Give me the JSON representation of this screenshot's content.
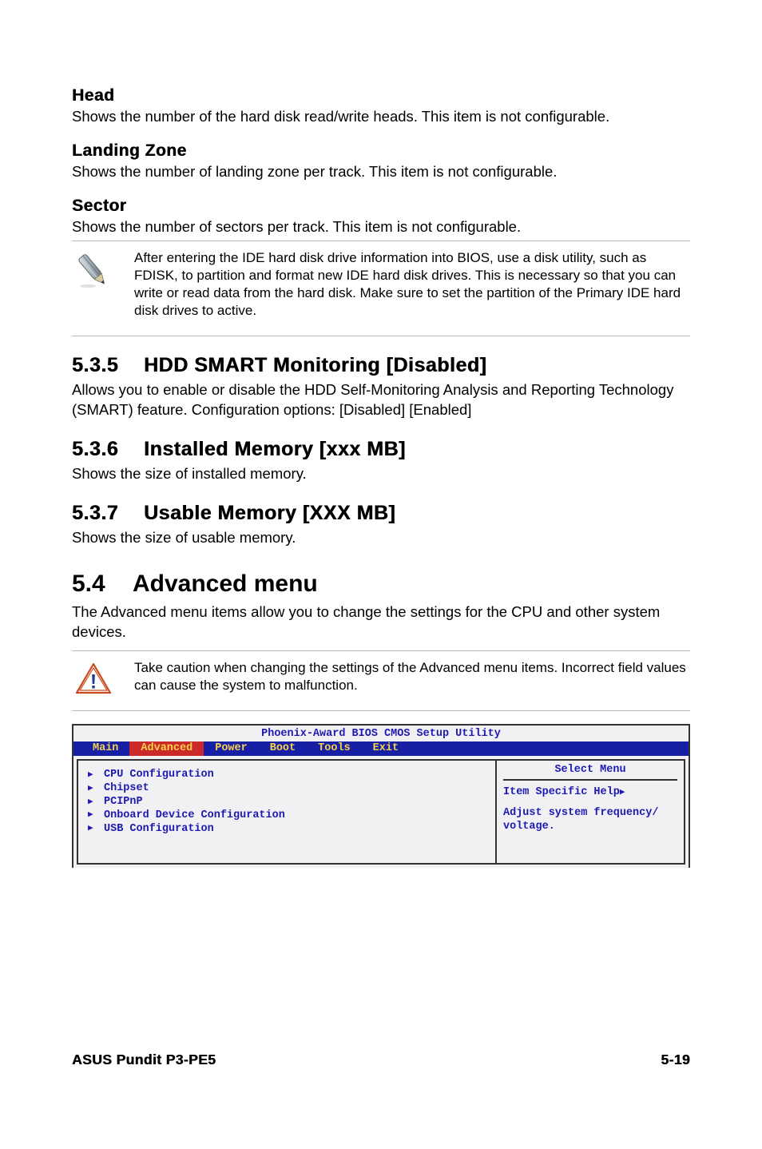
{
  "sections": {
    "head": {
      "title": "Head",
      "body": "Shows the number of the hard disk read/write heads. This item is not configurable."
    },
    "landing_zone": {
      "title": "Landing Zone",
      "body": "Shows the number of landing zone per track. This item is not configurable."
    },
    "sector": {
      "title": "Sector",
      "body": "Shows the number of sectors per track. This item is not configurable."
    },
    "note1": "After entering the IDE hard disk drive information into BIOS, use a disk utility, such as FDISK, to partition and format new IDE hard disk drives. This is necessary so that you can write or read data from the hard disk. Make sure to set the partition of the Primary IDE hard disk drives to active.",
    "s535": {
      "num": "5.3.5",
      "title": "HDD SMART Monitoring [Disabled]",
      "body": "Allows you to enable or disable the HDD Self-Monitoring Analysis and Reporting Technology (SMART) feature. Configuration options: [Disabled] [Enabled]"
    },
    "s536": {
      "num": "5.3.6",
      "title": "Installed Memory [xxx MB]",
      "body": "Shows the size of installed memory."
    },
    "s537": {
      "num": "5.3.7",
      "title": "Usable Memory [XXX MB]",
      "body": "Shows the size of usable memory."
    },
    "s54": {
      "num": "5.4",
      "title": "Advanced menu",
      "body": "The Advanced menu items allow you to change the settings for the CPU and other system devices."
    },
    "note2": "Take caution when changing the settings of the Advanced menu items. Incorrect field values can cause the system to malfunction."
  },
  "bios": {
    "title": "Phoenix-Award BIOS CMOS Setup Utility",
    "tabs": [
      "Main",
      "Advanced",
      "Power",
      "Boot",
      "Tools",
      "Exit"
    ],
    "selected_tab_index": 1,
    "items": [
      "CPU Configuration",
      "Chipset",
      "PCIPnP",
      "Onboard Device Configuration",
      "USB Configuration"
    ],
    "help_title": "Select Menu",
    "help_line1": "Item Specific Help",
    "help_line2": "Adjust system frequency/",
    "help_line3": "voltage."
  },
  "footer": {
    "left": "ASUS Pundit P3-PE5",
    "right": "5-19"
  }
}
